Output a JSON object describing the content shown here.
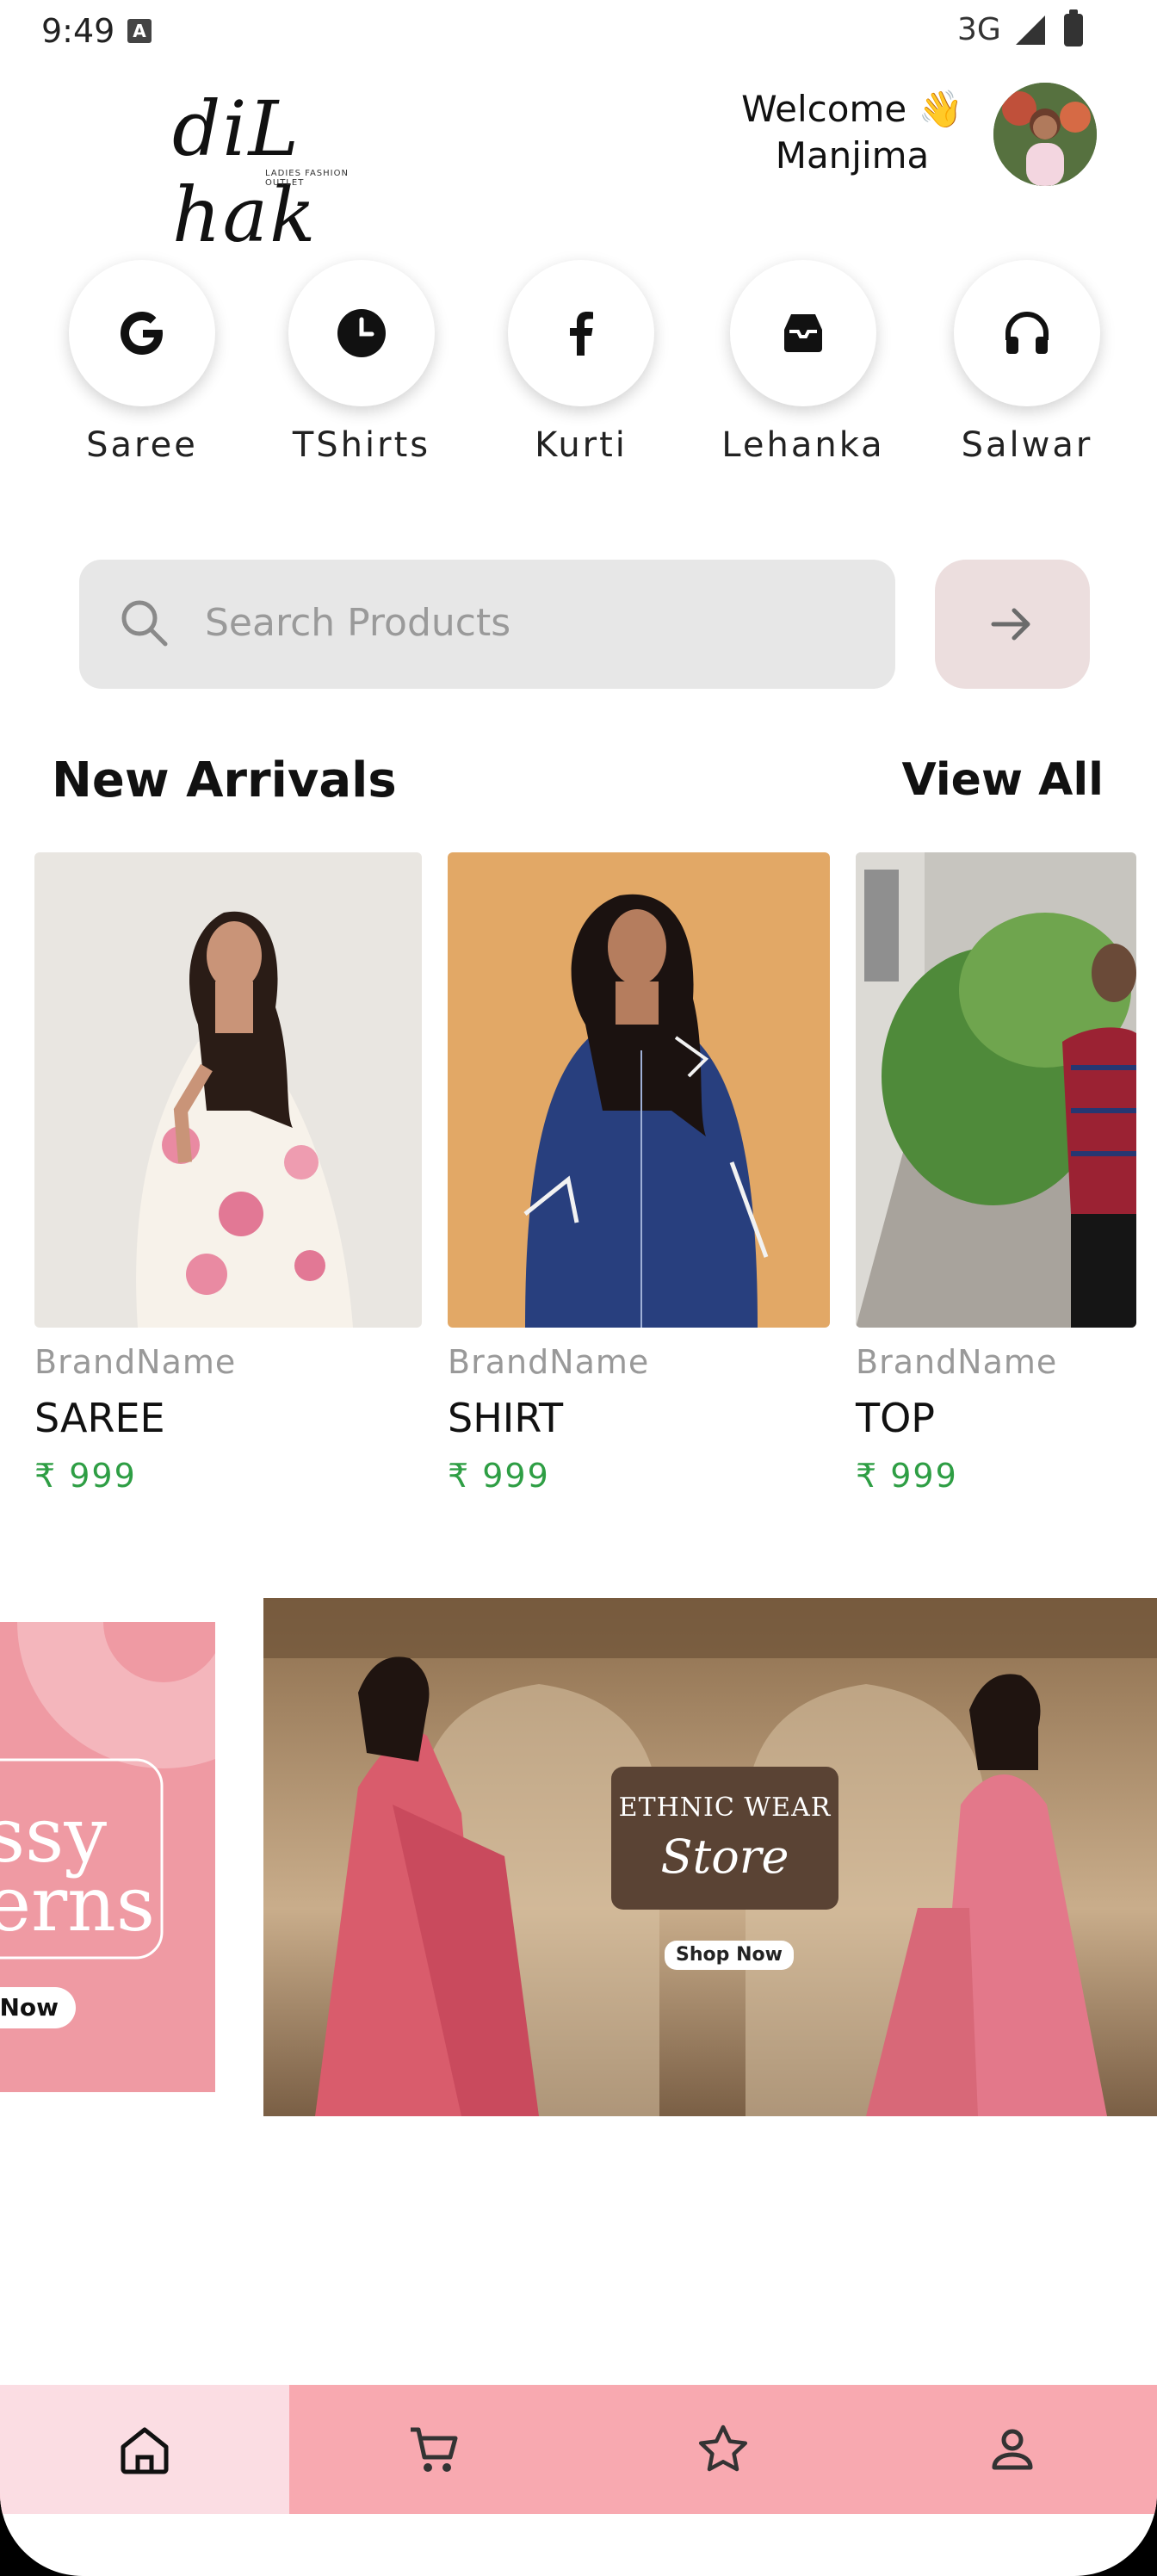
{
  "status_bar": {
    "time": "9:49",
    "network": "3G"
  },
  "header": {
    "logo_text": "diL hak",
    "logo_tagline": "LADIES FASHION OUTLET",
    "welcome_line1": "Welcome 👋",
    "welcome_line2": "Manjima"
  },
  "categories": [
    {
      "label": "Saree",
      "icon": "google-icon"
    },
    {
      "label": "TShirts",
      "icon": "clock-icon"
    },
    {
      "label": "Kurti",
      "icon": "facebook-icon"
    },
    {
      "label": "Lehanka",
      "icon": "inbox-icon"
    },
    {
      "label": "Salwar",
      "icon": "headphones-icon"
    }
  ],
  "search": {
    "placeholder": "Search Products"
  },
  "new_arrivals": {
    "title": "New Arrivals",
    "view_all": "View All",
    "products": [
      {
        "brand": "BrandName",
        "name": "SAREE",
        "price": "₹ 999"
      },
      {
        "brand": "BrandName",
        "name": "SHIRT",
        "price": "₹ 999"
      },
      {
        "brand": "BrandName",
        "name": "TOP",
        "price": "₹ 999"
      }
    ]
  },
  "banners": {
    "left": {
      "line1": "ssy",
      "line2": "erns",
      "button": "Now"
    },
    "main": {
      "title_top": "ETHNIC WEAR",
      "title_bottom": "Store",
      "button": "Shop Now"
    }
  },
  "bottom_nav": [
    {
      "icon": "home-icon",
      "active": true
    },
    {
      "icon": "cart-icon",
      "active": false
    },
    {
      "icon": "star-icon",
      "active": false
    },
    {
      "icon": "person-icon",
      "active": false
    }
  ],
  "colors": {
    "accent_pink": "#f8a9b0",
    "active_tab": "#fbdde3",
    "price_green": "#2e9e44"
  }
}
